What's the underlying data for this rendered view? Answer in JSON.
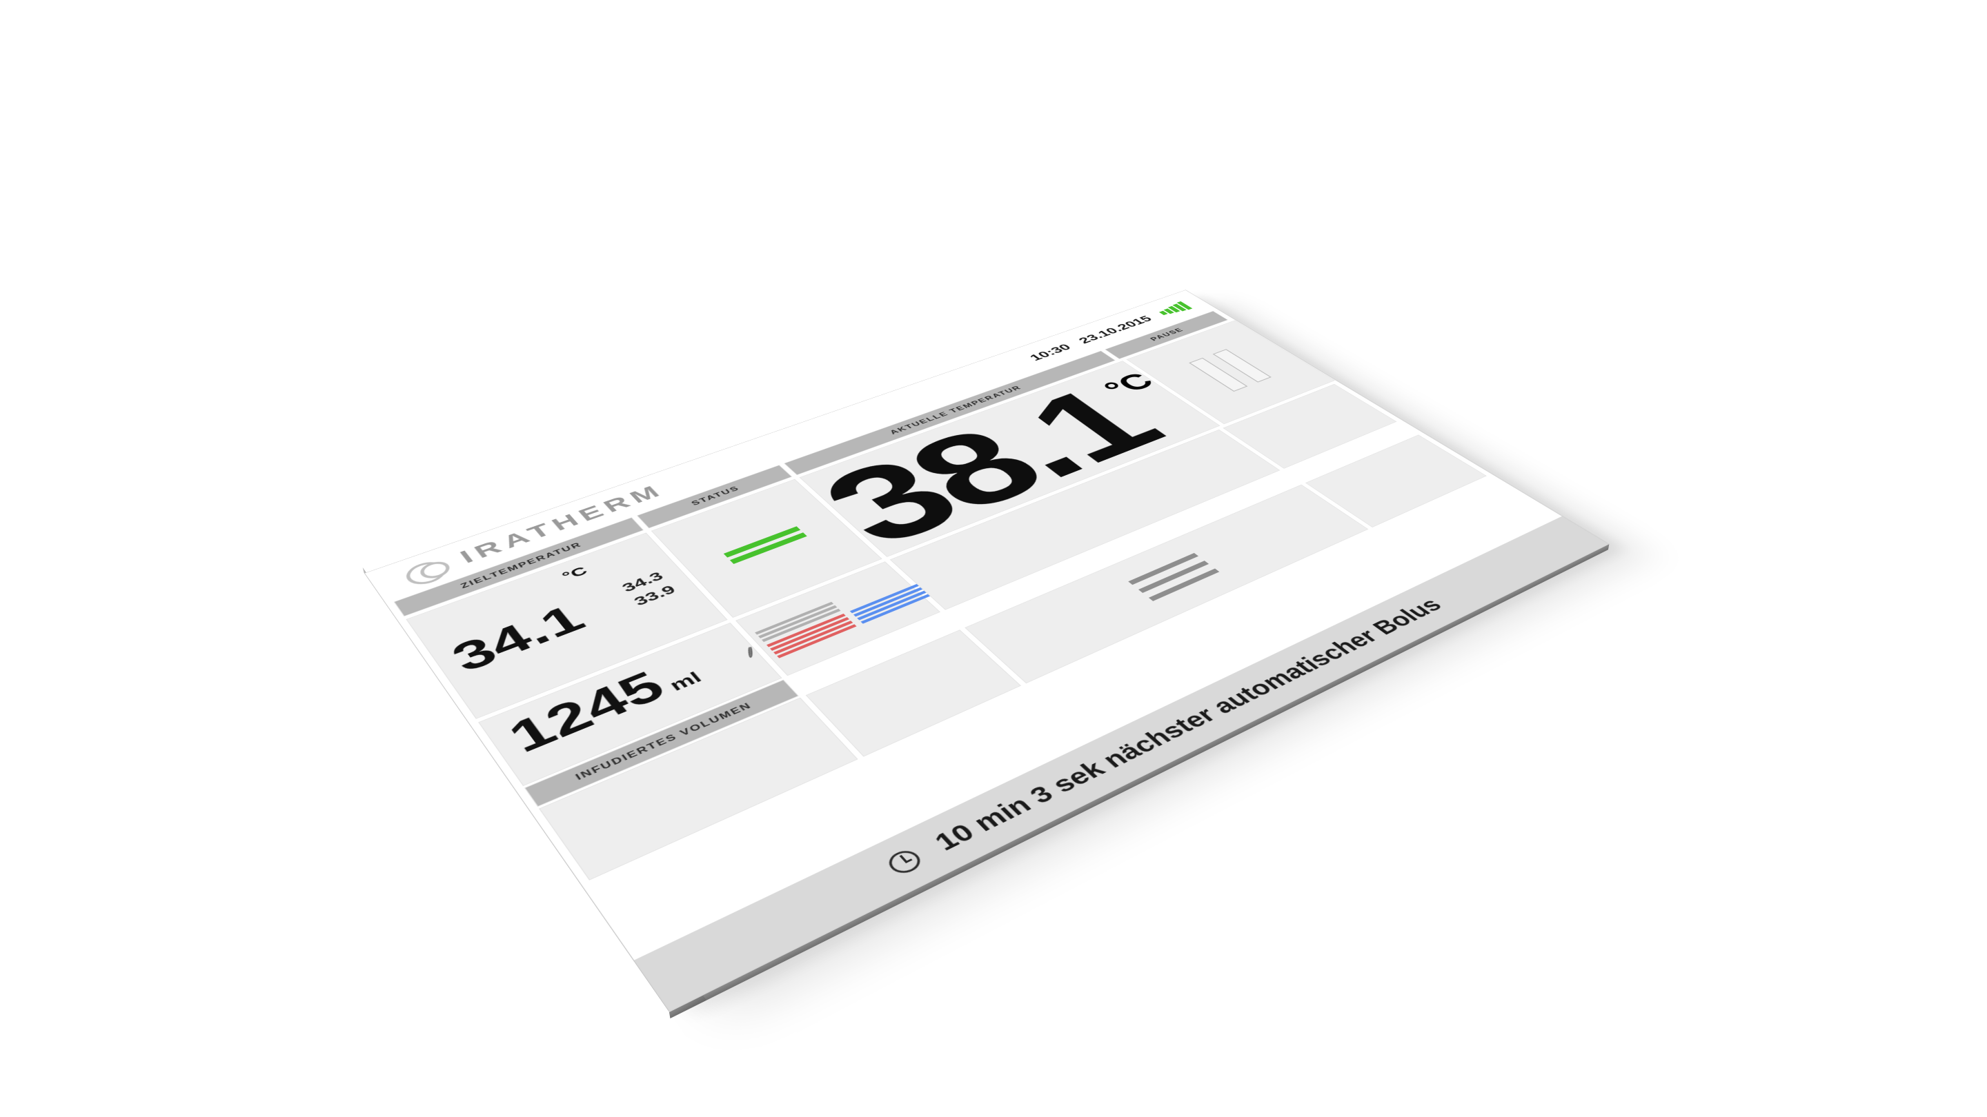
{
  "brand": "IRATHERM",
  "clock": {
    "time": "10:30",
    "date": "23.10.2015"
  },
  "labels": {
    "target_temp": "ZIELTEMPERATUR",
    "status": "STATUS",
    "current_temp": "AKTUELLE TEMPERATUR",
    "pause": "PAUSE",
    "infused_vol": "INFUDIERTES VOLUMEN"
  },
  "target_temperature": {
    "value": "34.1",
    "unit": "°C",
    "bounds_hi": "34.3",
    "bounds_lo": "33.9"
  },
  "current_temperature": {
    "value": "38.1",
    "unit": "°C"
  },
  "infused_volume": {
    "value": "1245",
    "unit": "ml"
  },
  "footer": {
    "text": "10 min 3 sek nächster automatischer Bolus"
  },
  "colors": {
    "accent_green": "#47c22d",
    "bar_red": "#e06060",
    "bar_blue": "#5a8ff0",
    "bar_grey": "#b0b0b0"
  }
}
